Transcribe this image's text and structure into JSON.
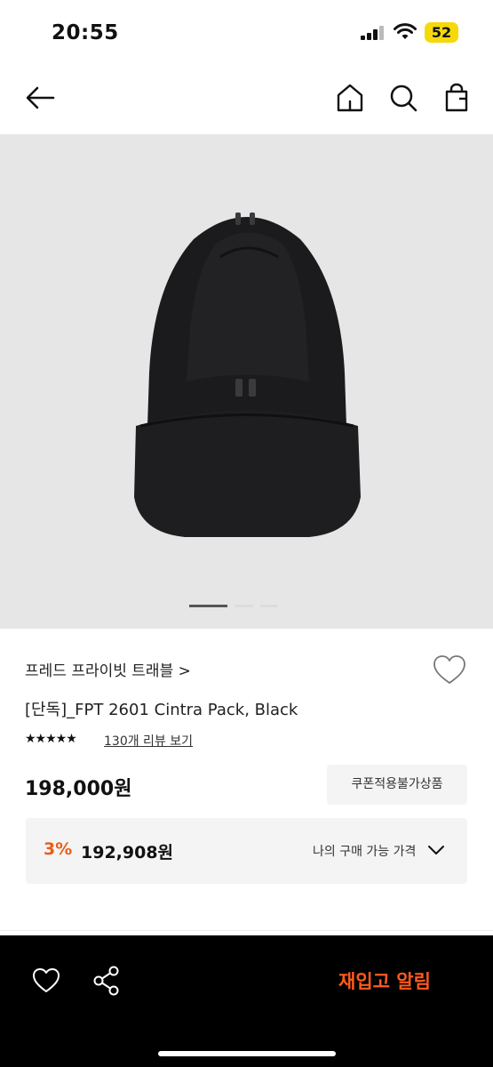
{
  "status_bar": {
    "time": "20:55",
    "battery": "52"
  },
  "brand": {
    "name": "프레드 프라이빗 트래블",
    "chevron": ">"
  },
  "product": {
    "title": "[단독]_FPT 2601 Cintra Pack, Black",
    "rating_stars": "★★★★★",
    "reviews": "130개 리뷰 보기",
    "price": "198,000원",
    "coupon_badge": "쿠폰적용불가상품"
  },
  "my_price": {
    "discount": "3%",
    "price": "192,908원",
    "label": "나의 구매 가능 가격"
  },
  "bottom_bar": {
    "restock_button": "재입고 알림"
  },
  "carousel": {
    "total": 3,
    "active": 1
  },
  "colors": {
    "accent": "#ff5a1f",
    "discount": "#e85d1a"
  }
}
